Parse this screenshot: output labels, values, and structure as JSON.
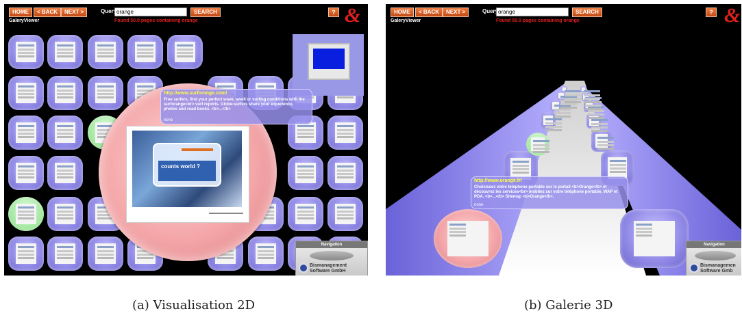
{
  "figure_2d": {
    "toolbar": {
      "home": "HOME",
      "back": "< BACK",
      "next": "NEXT >",
      "query_label": "Query",
      "query_value": "orange",
      "search": "SEARCH",
      "help": "?"
    },
    "app_name": "GaleryViewer",
    "found": "Found 50.0 pages containing orange",
    "tooltip": {
      "url": "http://www.surforange.com/",
      "text": "Free surfers, find your perfect wave, swell or surfing conditions with the surforange<br> surf reports. Globe-surfers share your experience, photos and road books. <b>...</b>",
      "foot": "none"
    },
    "thumb_heading": "counts world ?",
    "navigation": {
      "title": "Navigation",
      "brand_line1": "Bismanagement",
      "brand_line2": "Software GmbH"
    },
    "caption": "(a) Visualisation 2D"
  },
  "figure_3d": {
    "toolbar": {
      "home": "HOME",
      "back": "< BACK",
      "next": "NEXT >",
      "query_label": "Query",
      "query_value": "orange",
      "search": "SEARCH",
      "help": "?"
    },
    "app_name": "GaleryViewer",
    "found": "Found 50.0 pages containing orange",
    "tooltip": {
      "url": "http://www.orange.fr/",
      "text": "Choisissez votre téléphone portable sur le portail <b>Orange</b> et découvrez les services<br> mobiles sur votre téléphone portable, WAP et PDA. <b>...</b> Sitemap <b>Orange</b>.",
      "foot": "none"
    },
    "navigation": {
      "title": "Navigation",
      "brand_line1": "Bismanagemen",
      "brand_line2": "Software Gmb"
    },
    "caption": "(b) Galerie 3D"
  },
  "colors": {
    "tile": "#8f88e6",
    "highlight": "#9ee69a",
    "magnifier": "#f4a6a8",
    "button": "#e0601c",
    "url": "#ffff40",
    "found": "#e02020"
  },
  "icons": [
    "help-icon",
    "orange-logo-icon",
    "navigation-compass-icon",
    "bismanagement-logo-icon"
  ]
}
